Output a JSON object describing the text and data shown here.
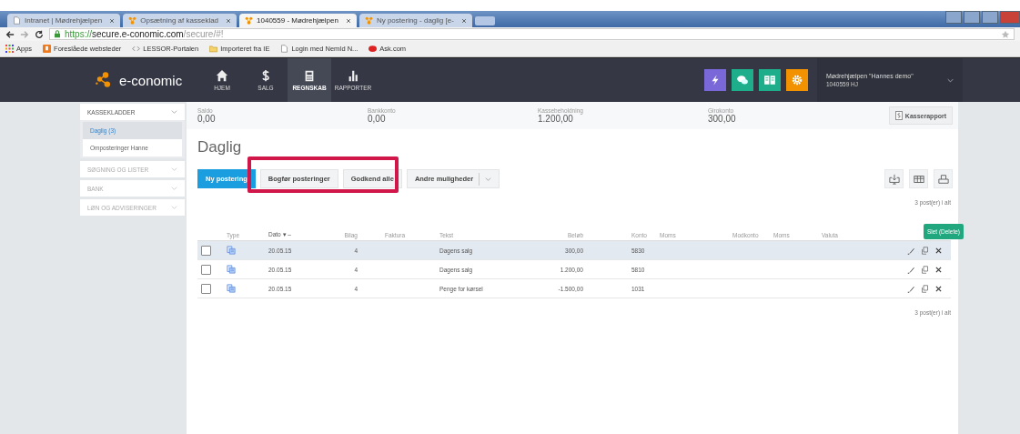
{
  "browser": {
    "tabs": [
      {
        "title": "Intranet | Mødrehjælpen",
        "selected": false
      },
      {
        "title": "Opsætning af kasseklad",
        "selected": false
      },
      {
        "title": "1040559 - Mødrehjælpen",
        "selected": true
      },
      {
        "title": "Ny postering - daglig [e-",
        "selected": false
      }
    ],
    "url": {
      "scheme": "https://",
      "host": "secure.e-conomic.com",
      "path": "/secure/#!"
    },
    "bookmarks": [
      {
        "label": "Apps"
      },
      {
        "label": "Foreslåede websteder"
      },
      {
        "label": "LESSOR-Portalen"
      },
      {
        "label": "Importeret fra IE"
      },
      {
        "label": "Login med NemId N..."
      },
      {
        "label": "Ask.com"
      }
    ]
  },
  "app": {
    "logo": "e-conomic",
    "nav": [
      {
        "label": "HJEM",
        "selected": false
      },
      {
        "label": "SALG",
        "selected": false
      },
      {
        "label": "REGNSKAB",
        "selected": true
      },
      {
        "label": "RAPPORTER",
        "selected": false
      }
    ],
    "quick": [
      {
        "color": "#7b68d8"
      },
      {
        "color": "#1fae8c"
      },
      {
        "color": "#1fae8c"
      },
      {
        "color": "#f39200"
      }
    ],
    "user": {
      "name": "Mødrehjælpen \"Hannes demo\"",
      "id": "1040559 HJ"
    }
  },
  "sidebar": [
    {
      "label": "KASSEKLADDER",
      "expanded": true,
      "children": [
        {
          "label": "Daglig (3)",
          "selected": true
        },
        {
          "label": "Omposteringer Hanne",
          "selected": false
        }
      ]
    },
    {
      "label": "SØGNING OG LISTER",
      "expanded": false
    },
    {
      "label": "BANK",
      "expanded": false
    },
    {
      "label": "LØN OG ADVISERINGER",
      "expanded": false
    }
  ],
  "summary": [
    {
      "label": "Saldo",
      "value": "0,00"
    },
    {
      "label": "Bankkonto",
      "value": "0,00"
    },
    {
      "label": "Kassebeholdning",
      "value": "1.200,00"
    },
    {
      "label": "Girokonto",
      "value": "300,00"
    }
  ],
  "report_button": "Kasserapport",
  "title": "Daglig",
  "toolbar": [
    {
      "label": "Ny postering",
      "kind": "primary"
    },
    {
      "label": "Bogfør posteringer",
      "kind": "default"
    },
    {
      "label": "Godkend alle",
      "kind": "default"
    },
    {
      "label": "Andre muligheder",
      "kind": "dropdown"
    }
  ],
  "count_top": "3 post(er) i alt",
  "columns": [
    "Type",
    "Dato ▾ –",
    "Bilag",
    "Faktura",
    "Tekst",
    "Beløb",
    "Konto",
    "Moms",
    "Modkonto",
    "Moms",
    "Valuta"
  ],
  "rows": [
    {
      "checked": false,
      "highlighted": true,
      "date": "20.05.15",
      "bilag": "4",
      "tekst": "Dagens salg",
      "belob": "300,00",
      "konto": "5830"
    },
    {
      "checked": false,
      "highlighted": false,
      "date": "20.05.15",
      "bilag": "4",
      "tekst": "Dagens salg",
      "belob": "1.200,00",
      "konto": "5810"
    },
    {
      "checked": false,
      "highlighted": false,
      "date": "20.05.15",
      "bilag": "4",
      "tekst": "Penge for kørsel",
      "belob": "-1.500,00",
      "konto": "1031"
    }
  ],
  "tooltip": "Slet (Delete)",
  "count_bottom": "3 post(er) i alt"
}
